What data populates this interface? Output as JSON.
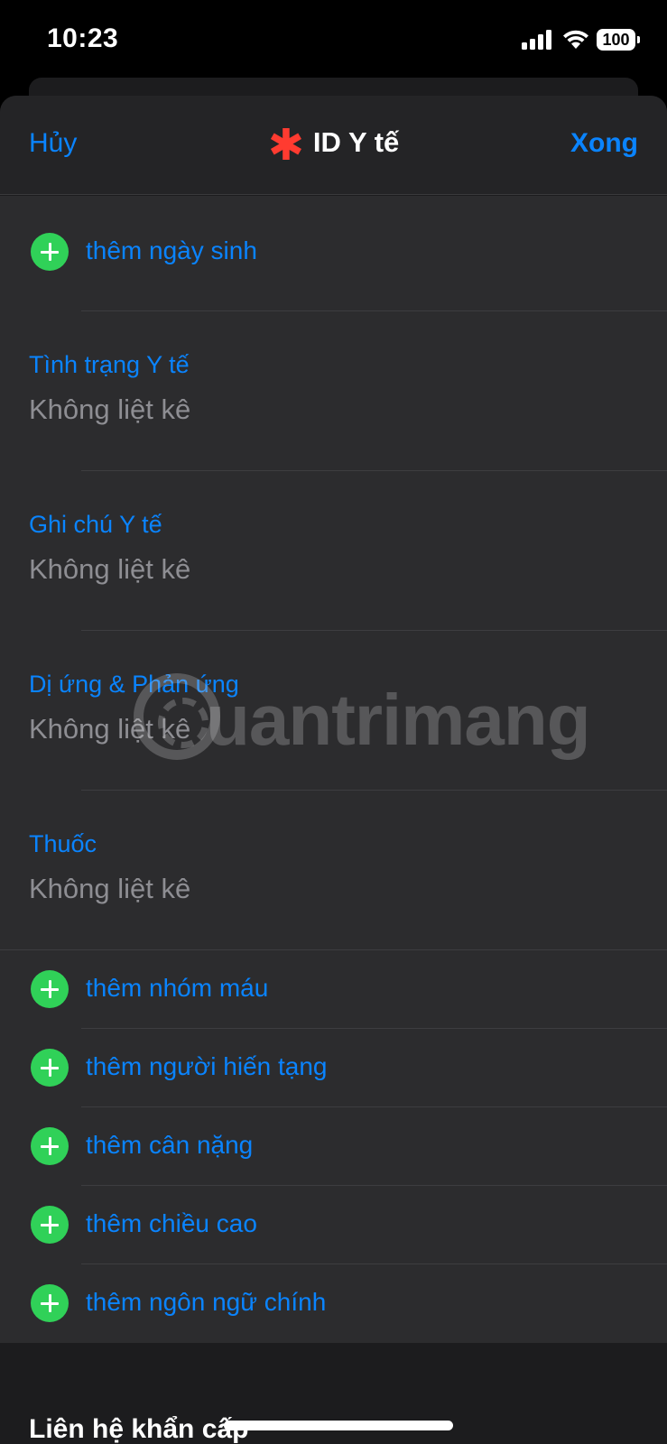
{
  "status_bar": {
    "time": "10:23",
    "battery": "100"
  },
  "sheet": {
    "cancel_label": "Hủy",
    "title_icon": "red-asterisk-icon",
    "title": "ID Y tế",
    "done_label": "Xong"
  },
  "list": {
    "add_birthdate": "thêm ngày sinh",
    "medical_conditions": {
      "label": "Tình trạng Y tế",
      "value": "Không liệt kê"
    },
    "medical_notes": {
      "label": "Ghi chú Y tế",
      "value": "Không liệt kê"
    },
    "allergies": {
      "label": "Dị ứng & Phản ứng",
      "value": "Không liệt kê"
    },
    "medications": {
      "label": "Thuốc",
      "value": "Không liệt kê"
    },
    "add_items": [
      "thêm nhóm máu",
      "thêm người hiến tạng",
      "thêm cân nặng",
      "thêm chiều cao",
      "thêm ngôn ngữ chính"
    ]
  },
  "section": {
    "emergency_contacts_title": "Liên hệ khẩn cấp"
  },
  "watermark": "uantrimang",
  "colors": {
    "accent": "#0a84ff",
    "add_green": "#30d158",
    "asterisk_red": "#ff3b30",
    "background": "#1c1c1e",
    "cell": "#2c2c2e"
  }
}
